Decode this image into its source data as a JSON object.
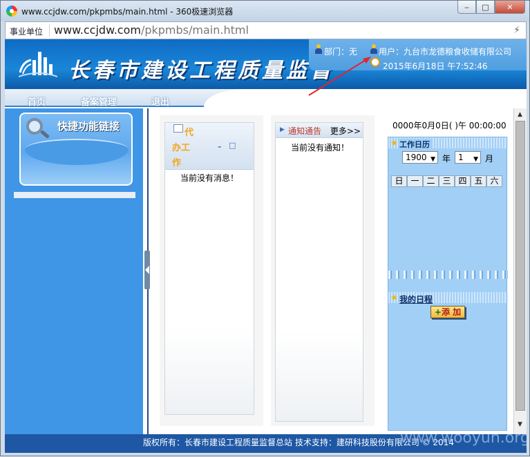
{
  "browser": {
    "title": "www.ccjdw.com/pkpmbs/main.html - 360极速浏览器",
    "unit_label": "事业单位",
    "url_domain": "www.ccjdw.com",
    "url_path": "/pkpmbs/main.html",
    "minimize_icon": "minimize-icon",
    "maximize_icon": "maximize-icon",
    "close_icon": "close-icon",
    "bolt_icon": "lightning-icon"
  },
  "header": {
    "site_title": "长春市建设工程质量监督",
    "department": "部门：无",
    "user": "用户：九台市龙德粮食收储有限公司",
    "datetime": "2015年6月18日 午7:52:46"
  },
  "nav": {
    "items": [
      "首页",
      "备案管理",
      "退出"
    ]
  },
  "sidebar": {
    "quick_links_title": "快捷功能链接"
  },
  "todo": {
    "title": "代办工作",
    "title_lines": [
      "代",
      "办工",
      "作"
    ],
    "minimize": "–",
    "maximize": "□",
    "empty_message": "当前没有消息！"
  },
  "notices": {
    "title": "通知通告",
    "more": "更多>>",
    "empty_message": "当前没有通知！"
  },
  "calendar": {
    "clock": "0000年0月0日( )午 00:00:00",
    "title": "工作日历",
    "year": "1900",
    "year_label": "年",
    "month": "1",
    "month_label": "月",
    "weekdays": [
      "日",
      "一",
      "二",
      "三",
      "四",
      "五",
      "六"
    ],
    "schedule_title": "我的日程",
    "add_plus": "+",
    "add_label": "添 加"
  },
  "footer": {
    "text": "版权所有：长春市建设工程质量监督总站 技术支持：建研科技股份有限公司 © 2014"
  },
  "watermark": "www.wooyun.org",
  "colors": {
    "banner_blue": "#1a86d8",
    "sidebar_blue": "#3f95e6",
    "footer_blue": "#1e57a4",
    "calendar_blue": "#a2cff6",
    "annotation_red": "#e0262b"
  }
}
